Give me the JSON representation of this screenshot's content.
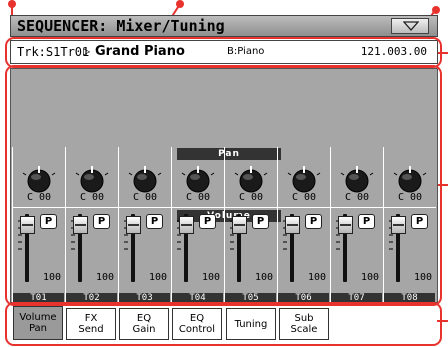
{
  "title_bar": {
    "title": "SEQUENCER: Mixer/Tuning",
    "menu_icon": "triangle-down-icon"
  },
  "info_bar": {
    "track_id": "Trk:S1Tr01",
    "song_name": "Grand Piano",
    "bank": "B:Piano",
    "position": "121.003.00"
  },
  "sections": {
    "pan_label": "Pan",
    "volume_label": "Volume"
  },
  "tracks": [
    {
      "label": "T01",
      "pan": "C 00",
      "volume": "100",
      "play_label": "P"
    },
    {
      "label": "T02",
      "pan": "C 00",
      "volume": "100",
      "play_label": "P"
    },
    {
      "label": "T03",
      "pan": "C 00",
      "volume": "100",
      "play_label": "P"
    },
    {
      "label": "T04",
      "pan": "C 00",
      "volume": "100",
      "play_label": "P"
    },
    {
      "label": "T05",
      "pan": "C 00",
      "volume": "100",
      "play_label": "P"
    },
    {
      "label": "T06",
      "pan": "C 00",
      "volume": "100",
      "play_label": "P"
    },
    {
      "label": "T07",
      "pan": "C 00",
      "volume": "100",
      "play_label": "P"
    },
    {
      "label": "T08",
      "pan": "C 00",
      "volume": "100",
      "play_label": "P"
    }
  ],
  "tabs": [
    {
      "line1": "Volume",
      "line2": "Pan",
      "active": true
    },
    {
      "line1": "FX",
      "line2": "Send",
      "active": false
    },
    {
      "line1": "EQ",
      "line2": "Gain",
      "active": false
    },
    {
      "line1": "EQ",
      "line2": "Control",
      "active": false
    },
    {
      "line1": "Tuning",
      "line2": "",
      "active": false
    },
    {
      "line1": "Sub",
      "line2": "Scale",
      "active": false
    }
  ],
  "colors": {
    "callout": "#e8322d",
    "panel_background": "#a6a6a6",
    "label_bar": "#333333"
  }
}
